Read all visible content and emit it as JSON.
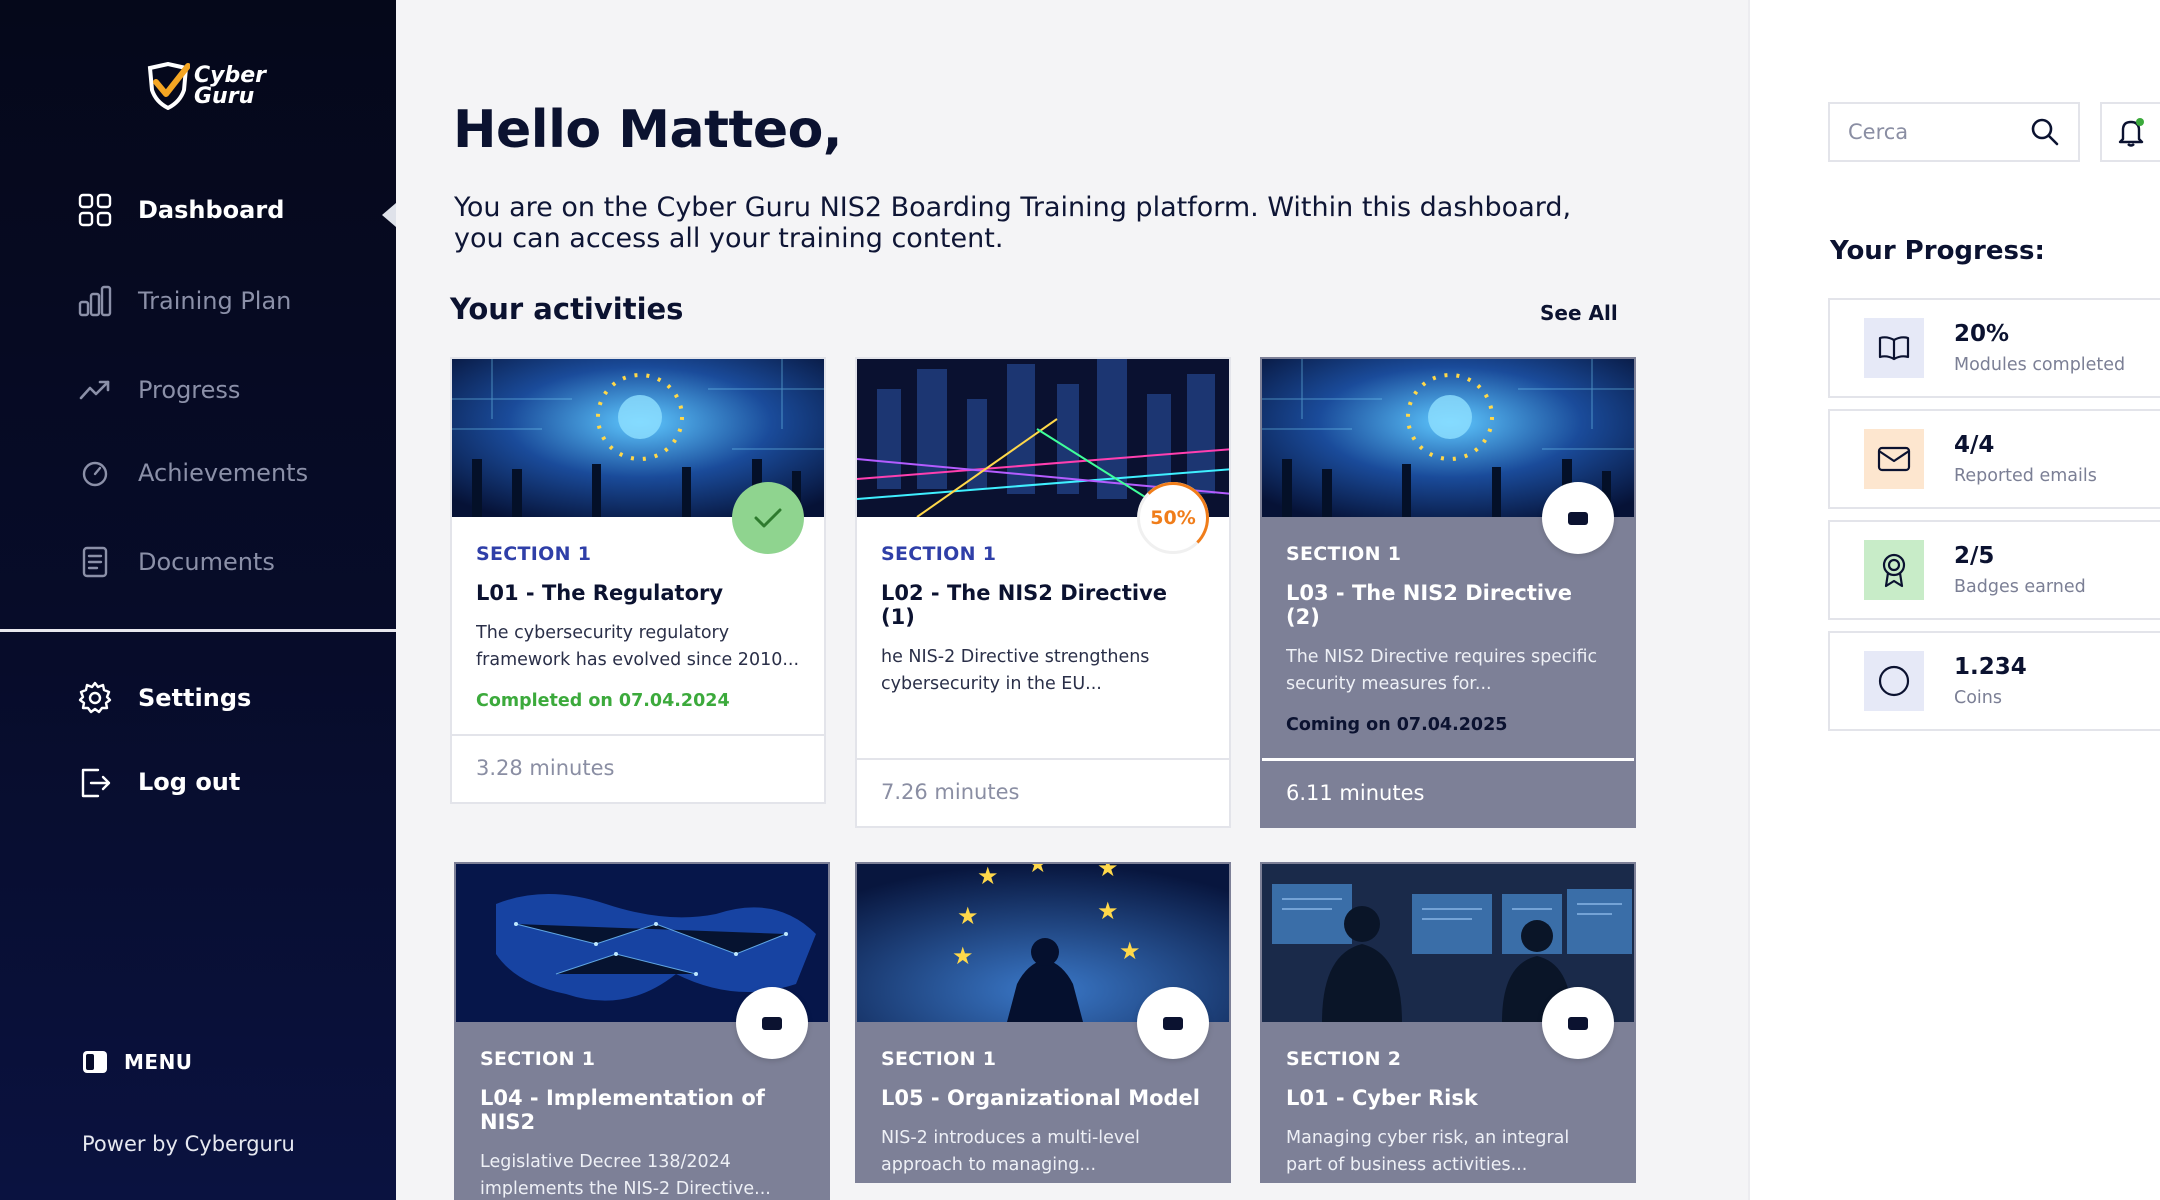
{
  "brand": {
    "logo_line1": "Cyber",
    "logo_line2": "Guru"
  },
  "sidebar": {
    "items": [
      {
        "label": "Dashboard",
        "icon": "dashboard-icon",
        "active": true
      },
      {
        "label": "Training Plan",
        "icon": "bar-chart-icon"
      },
      {
        "label": "Progress",
        "icon": "trend-icon"
      },
      {
        "label": "Achievements",
        "icon": "gauge-icon"
      },
      {
        "label": "Documents",
        "icon": "document-icon"
      }
    ],
    "bottom": [
      {
        "label": "Settings",
        "icon": "gear-icon"
      },
      {
        "label": "Log out",
        "icon": "logout-icon"
      }
    ],
    "menu_label": "MENU",
    "powered_by": "Power by Cyberguru"
  },
  "main": {
    "greeting": "Hello Matteo,",
    "intro": "You are on the Cyber Guru NIS2 Boarding Training platform. Within this dashboard, you can access all your training content.",
    "activities_title": "Your activities",
    "see_all": "See All",
    "cards": [
      {
        "section": "SECTION 1",
        "title": "L01 - The Regulatory",
        "desc": "The cybersecurity regulatory framework has evolved since 2010...",
        "status": "Completed on 07.04.2024",
        "duration": "3.28 minutes",
        "state": "completed"
      },
      {
        "section": "SECTION 1",
        "title": "L02 - The NIS2 Directive (1)",
        "desc": "he NIS-2 Directive strengthens cybersecurity in the EU...",
        "status": "",
        "duration": "7.26 minutes",
        "state": "in-progress",
        "progress_label": "50%"
      },
      {
        "section": "SECTION 1",
        "title": "L03 - The NIS2 Directive (2)",
        "desc": "The NIS2 Directive requires specific security measures for...",
        "status": "Coming on 07.04.2025",
        "duration": "6.11 minutes",
        "state": "locked"
      },
      {
        "section": "SECTION 1",
        "title": "L04 - Implementation of NIS2",
        "desc": "Legislative Decree 138/2024 implements the NIS-2 Directive...",
        "status": "",
        "duration": "",
        "state": "locked"
      },
      {
        "section": "SECTION 1",
        "title": "L05 - Organizational Model",
        "desc": "NIS-2 introduces a multi-level approach to managing...",
        "status": "",
        "duration": "",
        "state": "locked"
      },
      {
        "section": "SECTION 2",
        "title": "L01 - Cyber Risk",
        "desc": "Managing cyber risk, an integral part of business activities...",
        "status": "",
        "duration": "",
        "state": "locked"
      }
    ]
  },
  "right": {
    "search_placeholder": "Cerca",
    "progress_title": "Your Progress:",
    "stats": [
      {
        "value": "20%",
        "label": "Modules completed",
        "icon": "book-icon",
        "bg": "#e6e9f7"
      },
      {
        "value": "4/4",
        "label": "Reported emails",
        "icon": "mail-icon",
        "bg": "#fde6cf"
      },
      {
        "value": "2/5",
        "label": "Badges earned",
        "icon": "medal-icon",
        "bg": "#c8ecc8"
      },
      {
        "value": "1.234",
        "label": "Coins",
        "icon": "coin-icon",
        "bg": "#e6e9f7"
      }
    ]
  },
  "colors": {
    "sidebar_bg": "#05081a",
    "accent_blue": "#2f3fa8",
    "done_green": "#3caa3c",
    "progress_orange": "#f07d1a",
    "locked_gray": "#7d8097"
  }
}
